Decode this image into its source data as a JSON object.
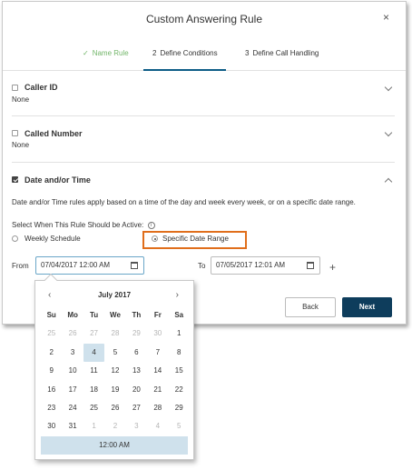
{
  "dialog": {
    "title": "Custom Answering Rule",
    "close": "×"
  },
  "steps": [
    {
      "num": "✓",
      "label": "Name Rule",
      "state": "done"
    },
    {
      "num": "2",
      "label": "Define Conditions",
      "state": "active"
    },
    {
      "num": "3",
      "label": "Define Call Handling",
      "state": "pending"
    }
  ],
  "caller_id": {
    "label": "Caller ID",
    "value": "None",
    "checked": false
  },
  "called_number": {
    "label": "Called Number",
    "value": "None",
    "checked": false
  },
  "date_time": {
    "label": "Date and/or Time",
    "checked": true,
    "description": "Date and/or Time rules apply based on a time of the day and week every week, or on a specific date range.",
    "select_label": "Select When This Rule Should be Active:",
    "info_icon": "i",
    "options": {
      "weekly": "Weekly Schedule",
      "specific": "Specific Date Range"
    },
    "selected_option": "specific",
    "from_label": "From",
    "from_value": "07/04/2017 12:00 AM",
    "to_label": "To",
    "to_value": "07/05/2017 12:01 AM",
    "add": "+"
  },
  "buttons": {
    "back": "Back",
    "next": "Next"
  },
  "datepicker": {
    "prev": "‹",
    "next": "›",
    "month": "July 2017",
    "weekdays": [
      "Su",
      "Mo",
      "Tu",
      "We",
      "Th",
      "Fr",
      "Sa"
    ],
    "weeks": [
      [
        "25",
        "26",
        "27",
        "28",
        "29",
        "30",
        "1"
      ],
      [
        "2",
        "3",
        "4",
        "5",
        "6",
        "7",
        "8"
      ],
      [
        "9",
        "10",
        "11",
        "12",
        "13",
        "14",
        "15"
      ],
      [
        "16",
        "17",
        "18",
        "19",
        "20",
        "21",
        "22"
      ],
      [
        "23",
        "24",
        "25",
        "26",
        "27",
        "28",
        "29"
      ],
      [
        "30",
        "31",
        "1",
        "2",
        "3",
        "4",
        "5"
      ]
    ],
    "selected_day": "4",
    "time": "12:00 AM"
  },
  "colors": {
    "accent": "#0e3d5c",
    "highlight": "#e06e1b",
    "done": "#73b66a",
    "selection": "#cfe1ec"
  }
}
